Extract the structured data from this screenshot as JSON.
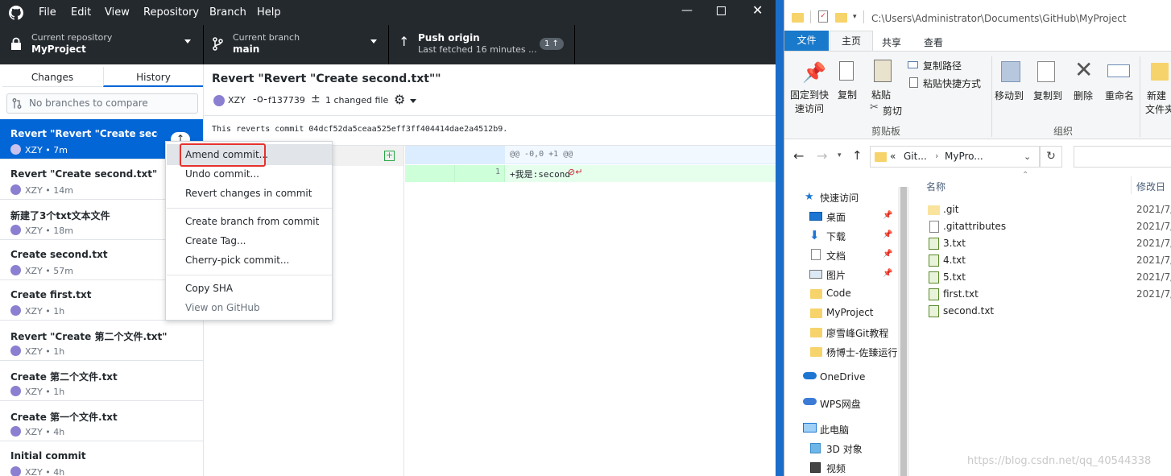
{
  "gh": {
    "menu": [
      "File",
      "Edit",
      "View",
      "Repository",
      "Branch",
      "Help"
    ],
    "repo_label": "Current repository",
    "repo_name": "MyProject",
    "branch_label": "Current branch",
    "branch_name": "main",
    "push_label": "Push origin",
    "push_sub": "Last fetched 16 minutes ...",
    "push_badge": "1 ↑",
    "tabs": [
      "Changes",
      "History"
    ],
    "compare_placeholder": "No branches to compare",
    "commits": [
      {
        "title": "Revert \"Revert \"Create seco...",
        "meta": "XZY • 7m"
      },
      {
        "title": "Revert \"Create second.txt\"",
        "meta": "XZY • 14m"
      },
      {
        "title": "新建了3个txt文本文件",
        "meta": "XZY • 18m"
      },
      {
        "title": "Create second.txt",
        "meta": "XZY • 57m"
      },
      {
        "title": "Create first.txt",
        "meta": "XZY • 1h"
      },
      {
        "title": "Revert \"Create 第二个文件.txt\"",
        "meta": "XZY • 1h"
      },
      {
        "title": "Create 第二个文件.txt",
        "meta": "XZY • 1h"
      },
      {
        "title": "Create 第一个文件.txt",
        "meta": "XZY • 4h"
      },
      {
        "title": "Initial commit",
        "meta": "XZY • 4h"
      }
    ],
    "detail": {
      "title": "Revert \"Revert \"Create second.txt\"\"",
      "author": "XZY",
      "sha": "f137739",
      "changed": "1 changed file",
      "message": "This reverts commit 04dcf52da5ceaa525eff3ff404414dae2a4512b9.",
      "hunk": "@@ -0,0 +1 @@",
      "line_no": "1",
      "line_text": "+我是:second"
    },
    "context_menu": [
      "Amend commit...",
      "Undo commit...",
      "Revert changes in commit",
      "Create branch from commit",
      "Create Tag...",
      "Cherry-pick commit...",
      "Copy SHA",
      "View on GitHub"
    ],
    "colors": {
      "dark": "#24292e",
      "selected": "#0366d6",
      "added": "#e6ffed",
      "highlight": "#e5322d"
    }
  },
  "explorer": {
    "path": "C:\\Users\\Administrator\\Documents\\GitHub\\MyProject",
    "menus": [
      "文件",
      "主页",
      "共享",
      "查看"
    ],
    "ribbon": {
      "pin": "固定到快",
      "pin2": "速访问",
      "copy": "复制",
      "paste": "粘贴",
      "copy_path": "复制路径",
      "paste_shortcut": "粘贴快捷方式",
      "cut": "剪切",
      "clipboard": "剪贴板",
      "move_to": "移动到",
      "copy_to": "复制到",
      "delete": "删除",
      "rename": "重命名",
      "organize": "组织",
      "new_folder": "新建",
      "new_folder2": "文件夹"
    },
    "breadcrumb": [
      "«",
      "Git...",
      "MyPro..."
    ],
    "nav": [
      "快速访问",
      "桌面",
      "下载",
      "文档",
      "图片",
      "Code",
      "MyProject",
      "廖雪峰Git教程",
      "杨博士-佐臻运行",
      "OneDrive",
      "WPS网盘",
      "此电脑",
      "3D 对象",
      "视频"
    ],
    "col_name": "名称",
    "col_date": "修改日",
    "files": [
      ".git",
      ".gitattributes",
      "3.txt",
      "4.txt",
      "5.txt",
      "first.txt",
      "second.txt"
    ],
    "date": "2021/7/",
    "watermark": "https://blog.csdn.net/qq_40544338"
  }
}
